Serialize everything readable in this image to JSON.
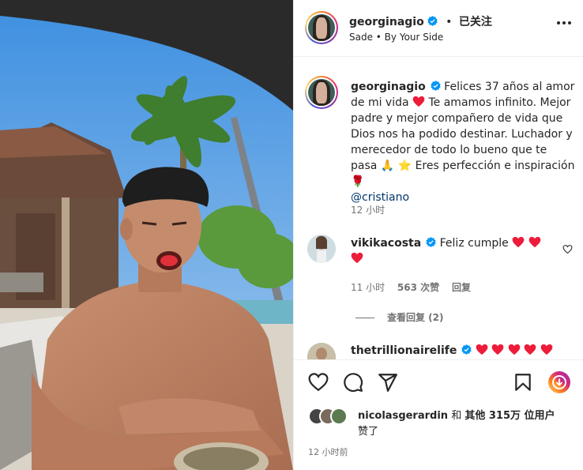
{
  "header": {
    "username": "georginagio",
    "separator": "•",
    "follow_status": "已关注",
    "music": "Sade • By Your Side"
  },
  "caption": {
    "username": "georginagio",
    "text_1": "Felices 37 años al amor de mi vida",
    "text_2": "Te amamos infinito. Mejor padre y mejor compañero de vida que Dios nos ha podido destinar. Luchador y merecedor de todo lo bueno que te pasa",
    "emoji_pray": "🙏",
    "emoji_star": "⭐",
    "text_3": "Eres perfección e inspiración",
    "emoji_rose": "🌹",
    "mention": "@cristiano",
    "time": "12 小时"
  },
  "comments": [
    {
      "username": "vikikacosta",
      "text": "Feliz cumple",
      "time": "11 小时",
      "likes": "563 次赞",
      "reply": "回复",
      "view_replies": "查看回复 (2)"
    },
    {
      "username": "thetrillionairelife"
    }
  ],
  "likes": {
    "user": "nicolasgerardin",
    "connector": "和",
    "others": "其他 315万 位用户",
    "suffix": "赞了"
  },
  "post_time": "12 小时前",
  "colors": {
    "verified": "#0095f6",
    "heart": "#ed1c3a",
    "mention": "#00376b",
    "secondary_text": "#737373"
  },
  "icons": [
    "verified-icon",
    "more-icon",
    "heart-icon",
    "comment-icon",
    "share-icon",
    "save-icon",
    "reels-play-icon"
  ]
}
